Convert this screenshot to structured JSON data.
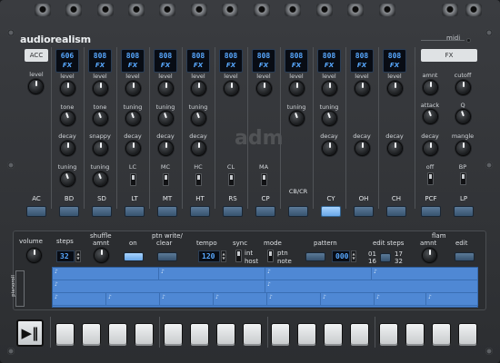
{
  "brand": {
    "logo": "audiorealism",
    "midi": "midi"
  },
  "watermark": "adm",
  "tabs": {
    "acc": "ACC",
    "fx": "FX"
  },
  "display": {
    "num": "808",
    "num_first": "606",
    "fx": "FX"
  },
  "knobs": {
    "level": "level",
    "tone": "tone",
    "tuning": "tuning",
    "decay": "decay",
    "snappy": "snappy",
    "amnt": "amnt",
    "cutoff": "cutoff",
    "attack": "attack",
    "q": "Q",
    "mangle": "mangle",
    "off": "off",
    "bp": "BP",
    "lc": "LC",
    "mc": "MC",
    "hc": "HC",
    "cl": "CL",
    "ma": "MA"
  },
  "instruments": [
    "AC",
    "BD",
    "SD",
    "LT",
    "MT",
    "HT",
    "RS",
    "CP",
    "CB/CR",
    "CY",
    "OH",
    "CH",
    "PCF",
    "LP"
  ],
  "sequencer": {
    "volume": "volume",
    "steps": "steps",
    "shuffle": "shuffle",
    "amnt": "amnt",
    "on": "on",
    "ptn_write": "ptn write/",
    "clear": "clear",
    "tempo": "tempo",
    "sync": "sync",
    "int": "int",
    "host": "host",
    "mode": "mode",
    "ptn": "ptn",
    "note": "note",
    "pattern": "pattern",
    "edit_steps": "edit steps",
    "s01": "01",
    "s16": "16",
    "s17": "17",
    "s32": "32",
    "flam": "flam",
    "flam_amnt": "amnt",
    "edit": "edit",
    "steps_value": "32",
    "tempo_value": "120",
    "pattern_value": "000",
    "side_label": "pianoroll"
  },
  "colors": {
    "accent": "#58a8ff",
    "button": "#4a6b8a",
    "grid": "#4f88d4"
  }
}
